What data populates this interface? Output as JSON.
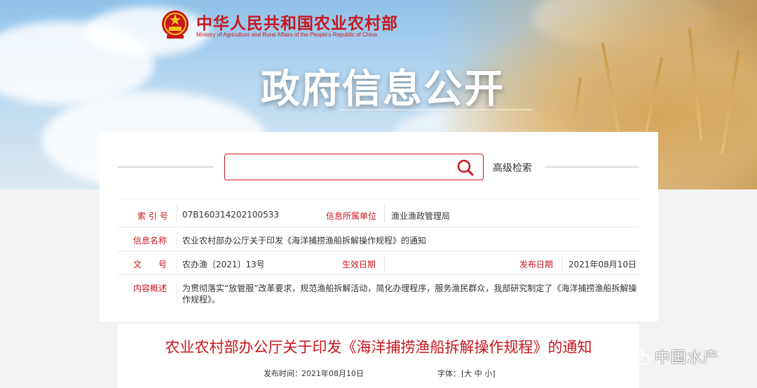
{
  "header": {
    "ministry_cn": "中华人民共和国农业农村部",
    "ministry_en": "Ministry of Agriculture and Rural Affairs of the People's Republic of China",
    "banner_title": "政府信息公开"
  },
  "search": {
    "placeholder": "",
    "advanced_label": "高级检索"
  },
  "info": {
    "index_label": "索 引 号",
    "index_value": "07B160314202100533",
    "unit_label": "信息所属单位",
    "unit_value": "渔业渔政管理局",
    "name_label": "信息名称",
    "name_value": "农业农村部办公厅关于印发《海洋捕捞渔船拆解操作规程》的通知",
    "doc_label": "文　　号",
    "doc_value": "农办渔〔2021〕13号",
    "effective_label": "生效日期",
    "effective_value": "",
    "publish_label": "发布日期",
    "publish_value": "2021年08月10日",
    "summary_label": "内容概述",
    "summary_line1": "为贯彻落实“放管服”改革要求，规范渔船拆解活动，简化办理程序，服务渔民群众，我部研究制定了《海洋捕捞渔船拆解操",
    "summary_line2": "作规程》。"
  },
  "article": {
    "title": "农业农村部办公厅关于印发《海洋捕捞渔船拆解操作规程》的通知",
    "publish_time_label": "发布时间：",
    "publish_time_value": "2021年08月10日",
    "font_label": "字体：",
    "font_options": "[大 中 小]"
  },
  "watermark": {
    "text": "中国水产"
  },
  "colors": {
    "accent": "#c8161d",
    "banner_sky": "#8fc1ea",
    "wheat": "#d6a458"
  },
  "icons": [
    "national-emblem-icon",
    "search-icon",
    "wechat-icon"
  ]
}
